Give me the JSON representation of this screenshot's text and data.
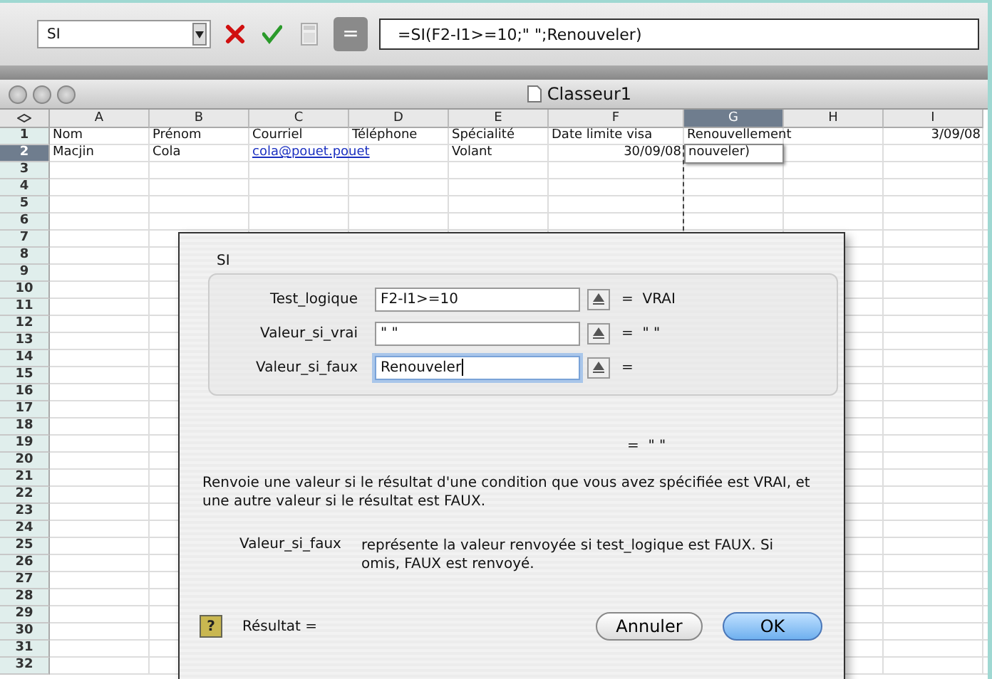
{
  "formula_bar": {
    "name_box": "SI",
    "formula": "=SI(F2-I1>=10;\" \";Renouveler)",
    "equals_button": "="
  },
  "window": {
    "title": "Classeur1"
  },
  "columns": [
    {
      "label": "A",
      "selected": false
    },
    {
      "label": "B",
      "selected": false
    },
    {
      "label": "C",
      "selected": false
    },
    {
      "label": "D",
      "selected": false
    },
    {
      "label": "E",
      "selected": false
    },
    {
      "label": "F",
      "selected": false
    },
    {
      "label": "G",
      "selected": true
    },
    {
      "label": "H",
      "selected": false
    },
    {
      "label": "I",
      "selected": false
    }
  ],
  "rows": [
    {
      "number": "1",
      "selected": false,
      "cells": [
        {
          "text": "Nom",
          "kind": "text"
        },
        {
          "text": "Prénom",
          "kind": "text"
        },
        {
          "text": "Courriel",
          "kind": "text"
        },
        {
          "text": "Téléphone",
          "kind": "text"
        },
        {
          "text": "Spécialité",
          "kind": "text"
        },
        {
          "text": "Date limite visa",
          "kind": "text"
        },
        {
          "text": "Renouvellement",
          "kind": "text"
        },
        null,
        {
          "text": "3/09/08",
          "kind": "number"
        }
      ]
    },
    {
      "number": "2",
      "selected": true,
      "cells": [
        {
          "text": "Macjin",
          "kind": "text"
        },
        {
          "text": "Cola",
          "kind": "text"
        },
        {
          "text": "cola@pouet.pouet",
          "kind": "link"
        },
        null,
        {
          "text": "Volant",
          "kind": "text"
        },
        {
          "text": "30/09/08",
          "kind": "number"
        },
        {
          "text": "nouveler)",
          "kind": "editing"
        },
        null,
        null
      ]
    },
    {
      "number": "3",
      "selected": false
    },
    {
      "number": "4",
      "selected": false
    },
    {
      "number": "5",
      "selected": false
    },
    {
      "number": "6",
      "selected": false
    },
    {
      "number": "7",
      "selected": false
    },
    {
      "number": "8",
      "selected": false
    },
    {
      "number": "9",
      "selected": false
    },
    {
      "number": "10",
      "selected": false
    },
    {
      "number": "11",
      "selected": false
    },
    {
      "number": "12",
      "selected": false
    },
    {
      "number": "13",
      "selected": false
    },
    {
      "number": "14",
      "selected": false
    },
    {
      "number": "15",
      "selected": false
    },
    {
      "number": "16",
      "selected": false
    },
    {
      "number": "17",
      "selected": false
    },
    {
      "number": "18",
      "selected": false
    },
    {
      "number": "19",
      "selected": false
    },
    {
      "number": "20",
      "selected": false
    },
    {
      "number": "21",
      "selected": false
    },
    {
      "number": "22",
      "selected": false
    },
    {
      "number": "23",
      "selected": false
    },
    {
      "number": "24",
      "selected": false
    },
    {
      "number": "25",
      "selected": false
    },
    {
      "number": "26",
      "selected": false
    },
    {
      "number": "27",
      "selected": false
    },
    {
      "number": "28",
      "selected": false
    },
    {
      "number": "29",
      "selected": false
    },
    {
      "number": "30",
      "selected": false
    },
    {
      "number": "31",
      "selected": false
    },
    {
      "number": "32",
      "selected": false
    }
  ],
  "dialog": {
    "function_name": "SI",
    "arguments": [
      {
        "label": "Test_logique",
        "value": "F2-I1>=10",
        "result": "=  VRAI",
        "focused": false
      },
      {
        "label": "Valeur_si_vrai",
        "value": "\" \"",
        "result": "=  \" \"",
        "focused": false
      },
      {
        "label": "Valeur_si_faux",
        "value": "Renouveler",
        "result": "=",
        "focused": true
      }
    ],
    "formula_result": "=  \" \"",
    "description": "Renvoie une valeur si le résultat d'une condition que vous avez spécifiée est VRAI, et une autre valeur si le résultat est FAUX.",
    "argument_name": "Valeur_si_faux",
    "argument_help": "représente la valeur renvoyée si test_logique est FAUX. Si omis, FAUX est renvoyé.",
    "result_label": "Résultat =",
    "help_button": "?",
    "buttons": [
      {
        "label": "Annuler",
        "default": false
      },
      {
        "label": "OK",
        "default": true
      }
    ]
  }
}
